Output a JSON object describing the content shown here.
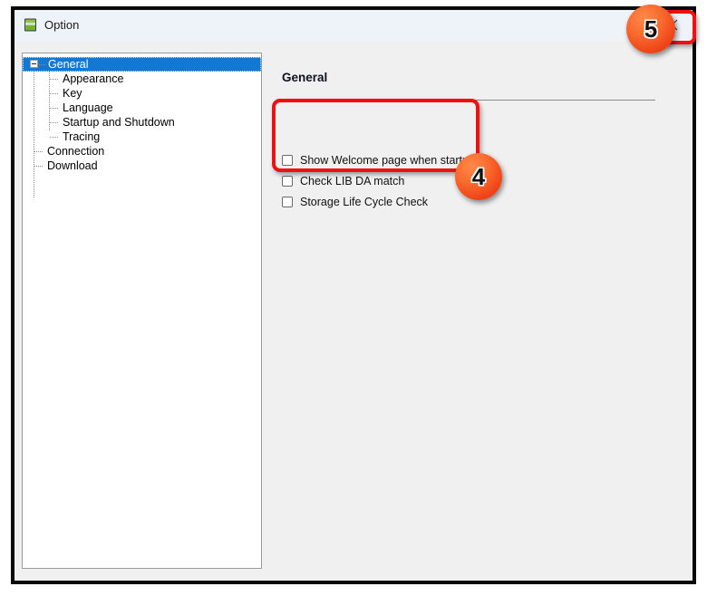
{
  "window": {
    "title": "Option",
    "icon": "application-icon",
    "close_label": "×"
  },
  "tree": {
    "items": [
      {
        "label": "General",
        "level": 0,
        "selected": true,
        "expander": "minus"
      },
      {
        "label": "Appearance",
        "level": 1,
        "selected": false
      },
      {
        "label": "Key",
        "level": 1,
        "selected": false
      },
      {
        "label": "Language",
        "level": 1,
        "selected": false
      },
      {
        "label": "Startup and Shutdown",
        "level": 1,
        "selected": false
      },
      {
        "label": "Tracing",
        "level": 1,
        "selected": false,
        "last_child": true
      },
      {
        "label": "Connection",
        "level": 0,
        "selected": false
      },
      {
        "label": "Download",
        "level": 0,
        "selected": false,
        "last_root": true
      }
    ]
  },
  "pane": {
    "title": "General",
    "options": [
      {
        "label": "Show Welcome page when startup",
        "checked": false
      },
      {
        "label": "Check LIB DA match",
        "checked": false
      },
      {
        "label": "Storage Life Cycle Check",
        "checked": false
      }
    ]
  },
  "annotations": {
    "color": "#f01010",
    "badges": [
      {
        "number": "4",
        "target": "options-group"
      },
      {
        "number": "5",
        "target": "close-button"
      }
    ]
  }
}
